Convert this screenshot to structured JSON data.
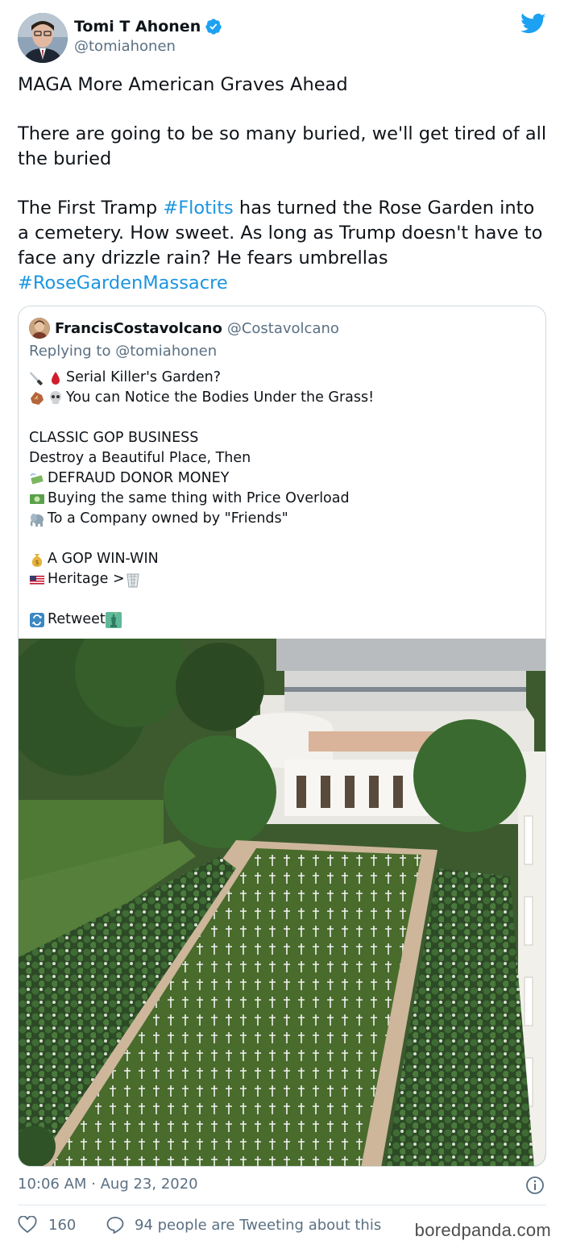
{
  "author": {
    "name": "Tomi T Ahonen",
    "handle": "@tomiahonen",
    "verified_icon": "verified-badge-icon",
    "brand_icon": "twitter-bird-icon"
  },
  "tweet": {
    "line1": "MAGA More American Graves Ahead",
    "line2": "There are going to be so many buried, we'll get tired of all the buried",
    "p3_a": "The First Tramp ",
    "p3_tag1": "#Flotits",
    "p3_b": " has turned the Rose Garden into a cemetery. How sweet. As long as Trump doesn't have to face any drizzle rain? He fears umbrellas ",
    "p3_tag2": "#RoseGardenMassacre"
  },
  "quote": {
    "name": "FrancisCostavolcano",
    "handle": "@Costavolcano",
    "replying_prefix": "Replying to ",
    "replying_handle": "@tomiahonen",
    "lines": {
      "l1": "Serial Killer's Garden?",
      "l2": "You can Notice the Bodies Under the Grass!",
      "l3": "CLASSIC GOP BUSINESS",
      "l4": "Destroy a Beautiful Place, Then",
      "l5": " DEFRAUD DONOR MONEY",
      "l6": "Buying the same thing with Price Overload",
      "l7": "To a Company owned by \"Friends\"",
      "l8": "A GOP WIN-WIN",
      "l9": " Heritage >",
      "l10": "Retweet"
    },
    "photo_icon": "rose-garden-crosses-photo"
  },
  "footer": {
    "timestamp": "10:06 AM · Aug 23, 2020",
    "likes": "160",
    "conversation": "94 people are Tweeting about this",
    "watermark": "boredpanda.com"
  },
  "colors": {
    "link": "#1b95e0",
    "muted": "#5b7083",
    "twitter_blue": "#1da1f2"
  }
}
